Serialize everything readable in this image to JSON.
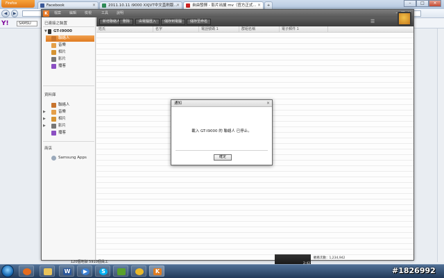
{
  "browser": {
    "firefox_button": "Firefox",
    "tabs": [
      {
        "label": "Facebook",
        "color": "#3b5998"
      },
      {
        "label": "2011.10.11 i9000 XXJVT中文直刷版...",
        "color": "#2e8b57"
      },
      {
        "label": "自由發揮 - 影片出爐 mv（官方正式...",
        "color": "#cc2222"
      }
    ],
    "url": "",
    "search": "SAMSU"
  },
  "kies": {
    "logo": "K",
    "menu": [
      "檔案",
      "編輯",
      "檢視",
      "工具",
      "說明"
    ],
    "sidebar": {
      "connected_header": "已連接之裝置",
      "device_name": "GT-I9000",
      "device_items": [
        "聯絡人",
        "音樂",
        "相片",
        "影片",
        "播客"
      ],
      "library_header": "資料庫",
      "library_items": [
        "聯絡人",
        "音樂",
        "相片",
        "影片",
        "播客"
      ],
      "store_header": "商店",
      "store_items": [
        "Samsung Apps"
      ]
    },
    "toolbar": [
      "新增聯絡人",
      "刪除",
      "由電腦匯入",
      "儲存到電腦",
      "儲存至命名"
    ],
    "columns": [
      "姓氏",
      "名字",
      "電話號碼 1",
      "群組名稱",
      "電子郵件 1"
    ],
    "dialog": {
      "title": "通知",
      "message": "載入 GT-I9000 的 聯絡人 已停止。",
      "ok": "確定"
    }
  },
  "page": {
    "caption": "120個地獄 5910個員工",
    "video_time": "2:42",
    "view_count": "觀看次數：1,234,942"
  },
  "taskbar": {
    "apps": [
      "firefox-icon",
      "explorer-icon",
      "word-icon",
      "player-icon",
      "skype-icon",
      "game-icon",
      "chat-icon",
      "kies-icon"
    ],
    "watermark": "#1826992"
  },
  "colors": {
    "accent": "#e07b20",
    "app_toolbar": "#4d4d4d"
  }
}
